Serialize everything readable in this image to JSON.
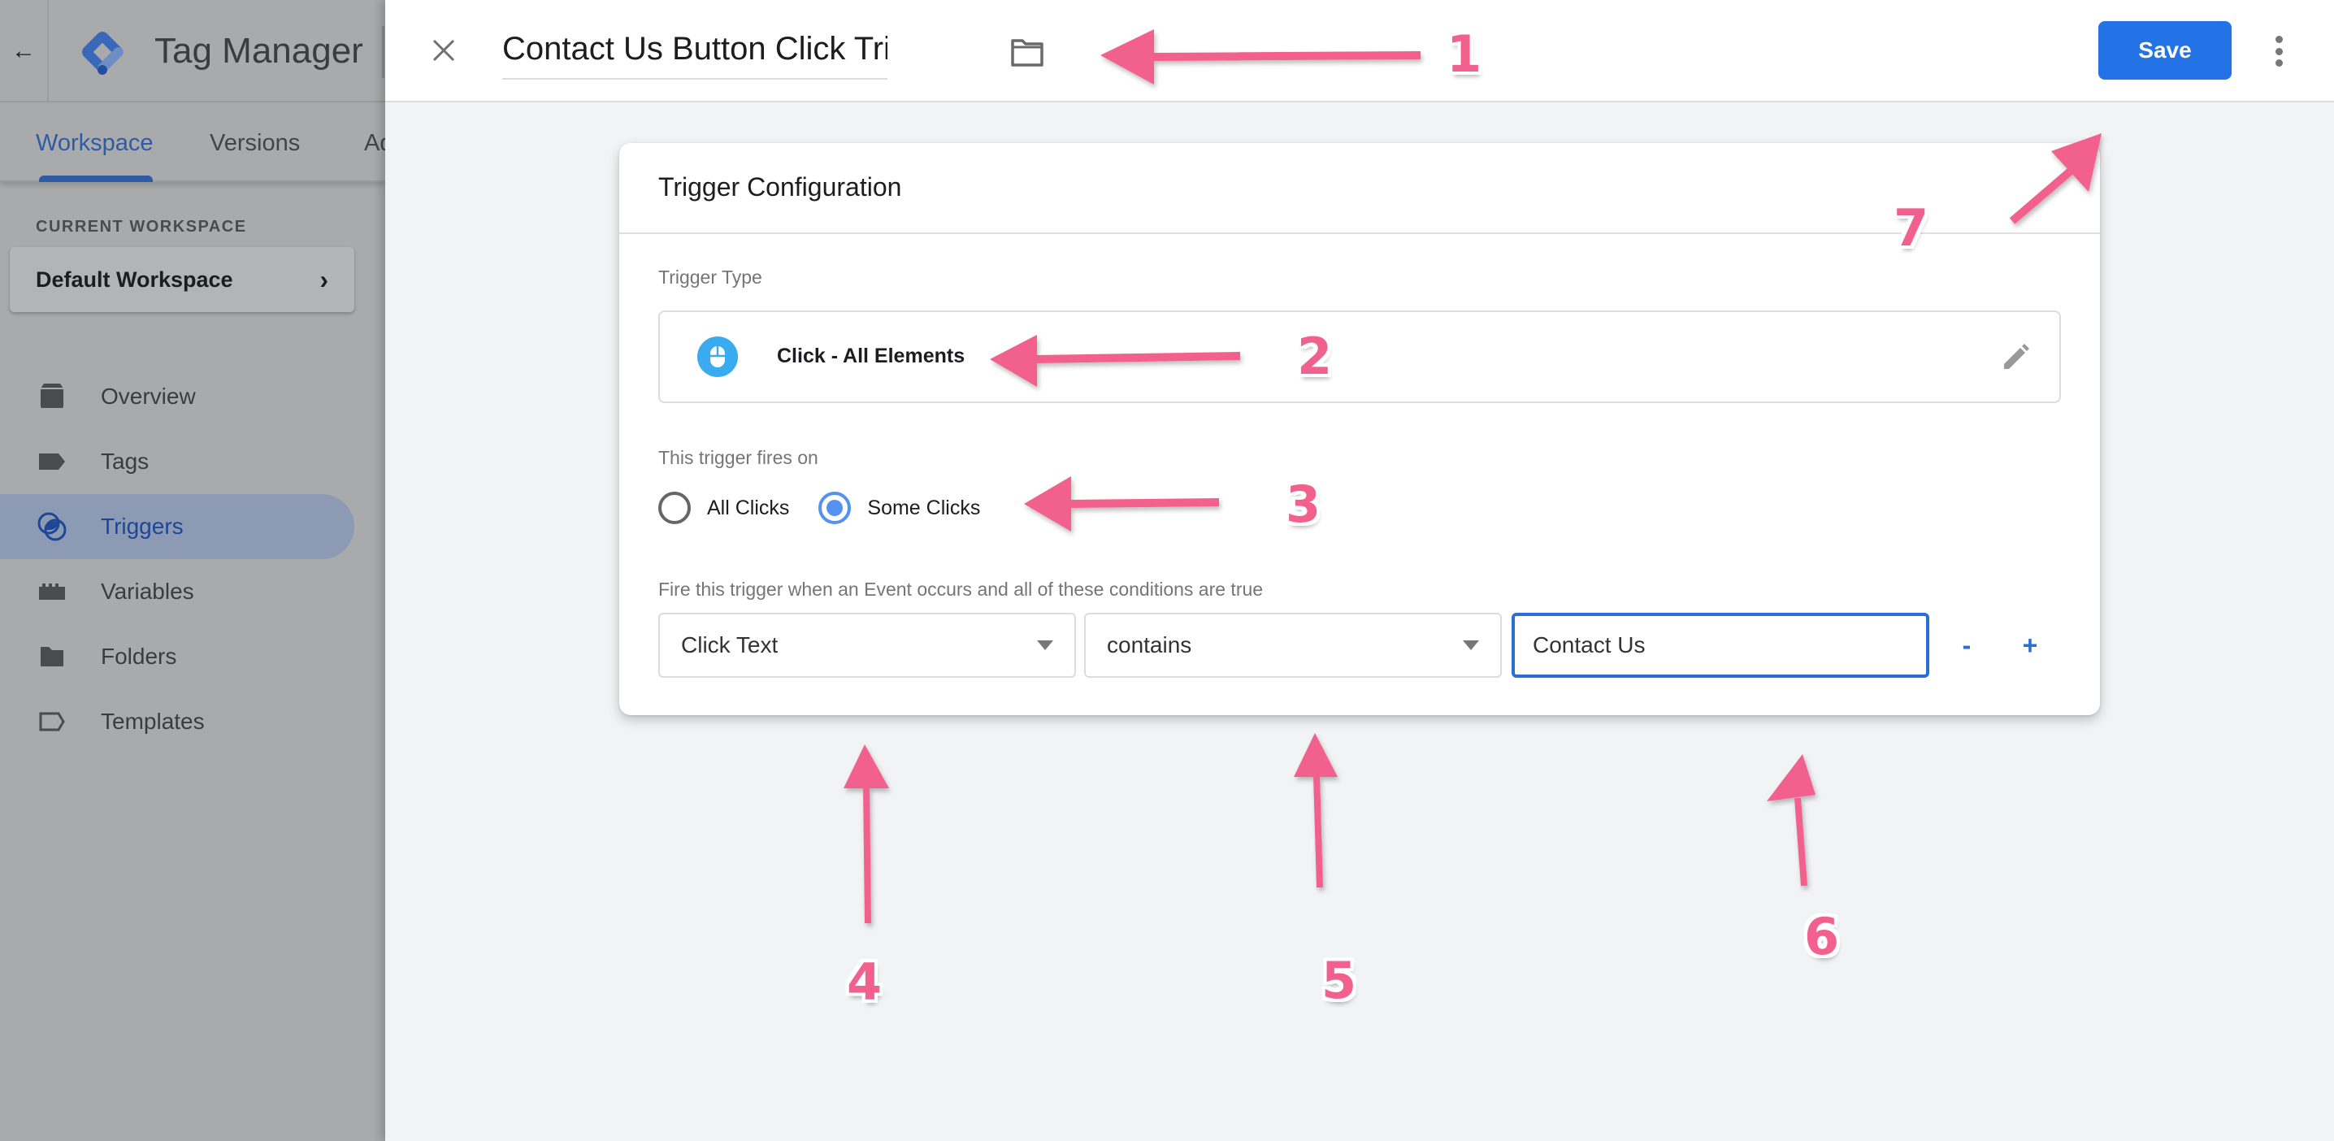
{
  "background_app": {
    "app_title": "Tag Manager",
    "tabs": [
      {
        "label": "Workspace",
        "active": true
      },
      {
        "label": "Versions",
        "active": false
      },
      {
        "label": "Ad",
        "active": false
      }
    ],
    "current_workspace_label": "CURRENT WORKSPACE",
    "current_workspace_name": "Default Workspace",
    "nav": [
      {
        "label": "Overview",
        "icon": "overview-icon",
        "active": false
      },
      {
        "label": "Tags",
        "icon": "tag-icon",
        "active": false
      },
      {
        "label": "Triggers",
        "icon": "trigger-icon",
        "active": true
      },
      {
        "label": "Variables",
        "icon": "variables-icon",
        "active": false
      },
      {
        "label": "Folders",
        "icon": "folder-icon",
        "active": false
      },
      {
        "label": "Templates",
        "icon": "template-icon",
        "active": false
      }
    ]
  },
  "panel": {
    "trigger_name": "Contact Us Button Click Trigger",
    "save_label": "Save"
  },
  "config": {
    "title": "Trigger Configuration",
    "trigger_type_label": "Trigger Type",
    "trigger_type_value": "Click - All Elements",
    "fires_on_label": "This trigger fires on",
    "fires_on_options": [
      {
        "label": "All Clicks",
        "checked": false
      },
      {
        "label": "Some Clicks",
        "checked": true
      }
    ],
    "conditions_label": "Fire this trigger when an Event occurs and all of these conditions are true",
    "condition": {
      "variable": "Click Text",
      "operator": "contains",
      "value": "Contact Us",
      "remove_label": "-",
      "add_label": "+"
    }
  },
  "annotations": {
    "color": "#f2608e",
    "labels": [
      "1",
      "2",
      "3",
      "4",
      "5",
      "6",
      "7"
    ]
  },
  "colors": {
    "primary": "#2473e6",
    "radio_checked": "#5591ef",
    "mouse_icon": "#3aabef"
  }
}
